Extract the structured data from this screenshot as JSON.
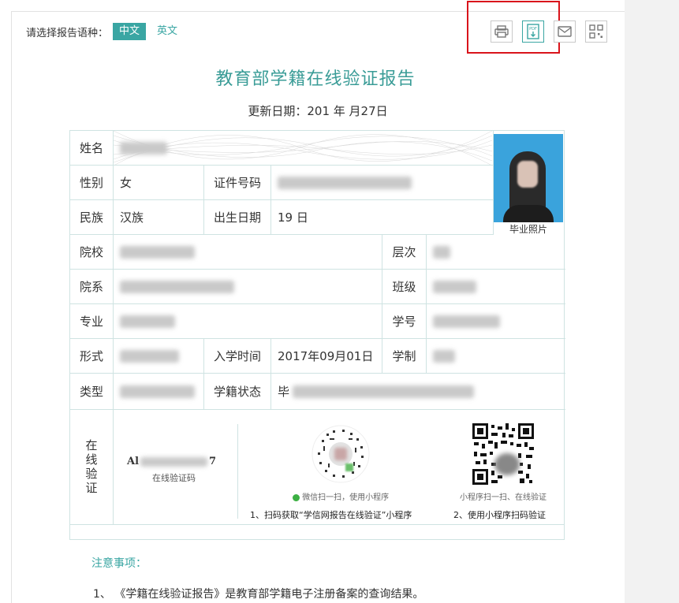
{
  "language": {
    "prompt": "请选择报告语种：",
    "options": [
      "中文",
      "英文"
    ],
    "selected": "中文"
  },
  "toolbar": {
    "icons": [
      "printer-icon",
      "pdf-download-icon",
      "mail-icon",
      "qr-code-icon"
    ],
    "highlight_color": "#d9141b"
  },
  "report": {
    "title": "教育部学籍在线验证报告",
    "update_date": "更新日期：201  年  月27日",
    "fields": {
      "name_label": "姓名",
      "gender_label": "性别",
      "gender_value": "女",
      "id_label": "证件号码",
      "ethnicity_label": "民族",
      "ethnicity_value": "汉族",
      "birth_label": "出生日期",
      "birth_value": "19                日",
      "school_label": "院校",
      "level_label": "层次",
      "dept_label": "院系",
      "class_label": "班级",
      "major_label": "专业",
      "student_no_label": "学号",
      "form_label": "形式",
      "enroll_label": "入学时间",
      "enroll_value": "2017年09月01日",
      "duration_label": "学制",
      "type_label": "类型",
      "status_label": "学籍状态",
      "status_value": "毕"
    },
    "photo_caption": "毕业照片",
    "verify": {
      "label": "在线验证",
      "code_prefix": "Al",
      "code_suffix": "7",
      "code_caption": "在线验证码",
      "mini_scan_hint": "微信扫一扫，使用小程序",
      "mini_step": "1、扫码获取“学信网报告在线验证”小程序",
      "qr_scan_hint": "小程序扫一扫、在线验证",
      "qr_step": "2、使用小程序扫码验证"
    },
    "notes_title": "注意事项：",
    "notes": [
      "1、 《学籍在线验证报告》是教育部学籍电子注册备案的查询结果。"
    ]
  },
  "colors": {
    "accent": "#3aa6a3",
    "title": "#3a9c97",
    "border": "#cfe3e2"
  }
}
